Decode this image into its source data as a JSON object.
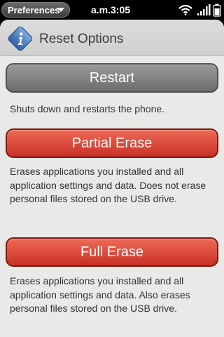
{
  "status_bar": {
    "app_menu": "Preferences",
    "clock": "a.m.3:05"
  },
  "header": {
    "title": "Reset Options"
  },
  "actions": [
    {
      "label": "Restart",
      "description": "Shuts down and restarts the phone."
    },
    {
      "label": "Partial Erase",
      "description": "Erases applications you installed and all application settings and data. Does not erase personal files stored on the USB drive."
    },
    {
      "label": "Full Erase",
      "description": "Erases applications you installed and all application settings and data. Also erases personal files stored on the USB drive."
    }
  ],
  "icons": {
    "app_menu": "chevron-down-icon",
    "header": "info-icon",
    "status": [
      "wifi-icon",
      "signal-icon",
      "battery-icon"
    ]
  },
  "colors": {
    "restart_button": "#7f7f7f",
    "erase_button": "#d84232",
    "background": "#e9e9e7"
  }
}
